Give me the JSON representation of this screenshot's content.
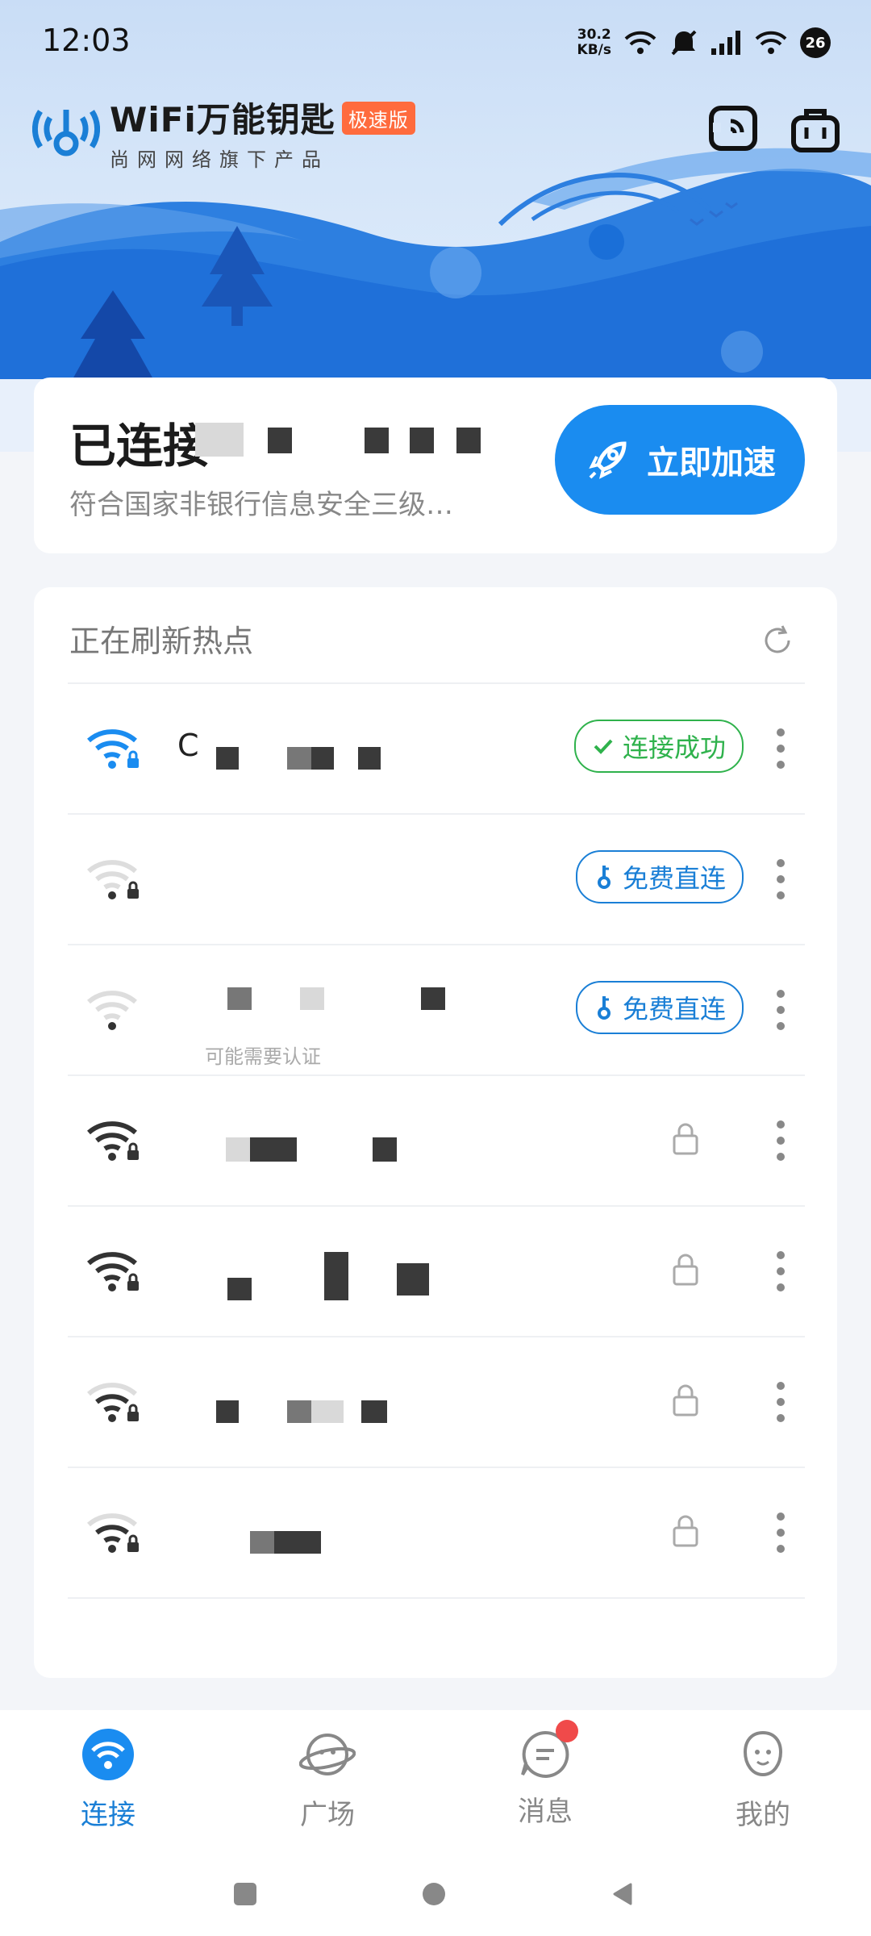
{
  "status_bar": {
    "time": "12:03",
    "net_speed_value": "30.2",
    "net_speed_unit": "KB/s",
    "badge": "26"
  },
  "header": {
    "app_name": "WiFi万能钥匙",
    "edition_tag": "极速版",
    "tagline": "尚网网络旗下产品"
  },
  "connected": {
    "title": "已连接",
    "subtitle": "符合国家非银行信息安全三级…",
    "speed_button": "立即加速"
  },
  "hotspots": {
    "header": "正在刷新热点",
    "items": [
      {
        "status": "连接成功",
        "status_type": "success",
        "signal": "strong",
        "locked": true
      },
      {
        "status": "免费直连",
        "status_type": "free",
        "signal": "weak",
        "locked": true
      },
      {
        "status": "免费直连",
        "status_type": "free",
        "signal": "weak",
        "locked": false,
        "sub": "可能需要认证"
      },
      {
        "status": "",
        "status_type": "locked",
        "signal": "strong",
        "locked": true
      },
      {
        "status": "",
        "status_type": "locked",
        "signal": "strong",
        "locked": true
      },
      {
        "status": "",
        "status_type": "locked",
        "signal": "medium",
        "locked": true
      },
      {
        "status": "",
        "status_type": "locked",
        "signal": "medium",
        "locked": true
      }
    ]
  },
  "bottom_nav": {
    "connect": "连接",
    "plaza": "广场",
    "messages": "消息",
    "mine": "我的"
  },
  "colors": {
    "accent": "#1a8cf0",
    "success": "#2fb24c",
    "badge_red": "#f04a4a"
  }
}
